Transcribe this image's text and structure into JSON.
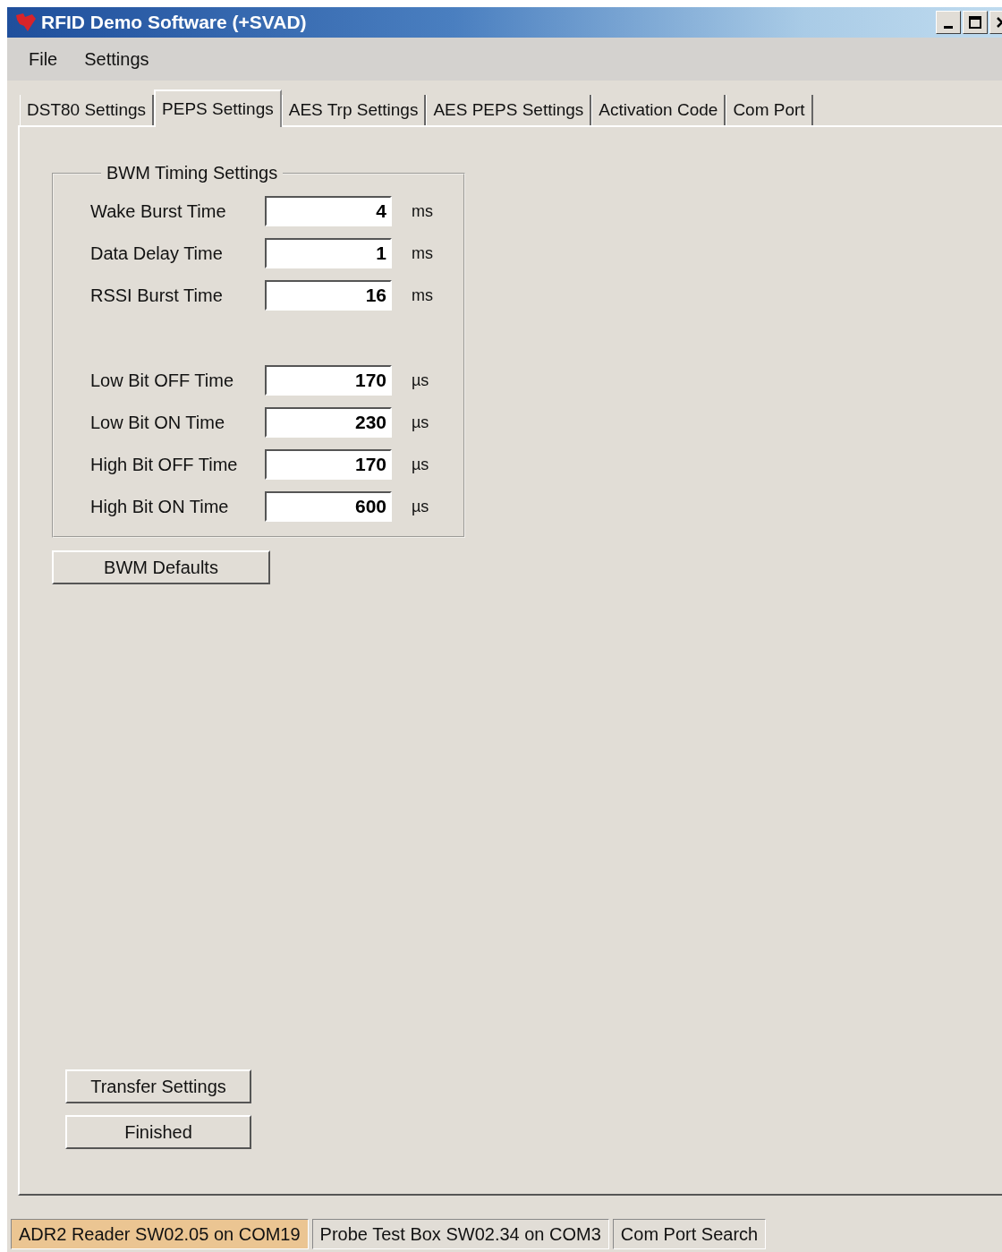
{
  "window": {
    "title": "RFID Demo Software (+SVAD)"
  },
  "menu": [
    "File",
    "Settings"
  ],
  "tabs": [
    {
      "label": "DST80 Settings",
      "selected": false
    },
    {
      "label": "PEPS Settings",
      "selected": true
    },
    {
      "label": "AES Trp Settings",
      "selected": false
    },
    {
      "label": "AES PEPS Settings",
      "selected": false
    },
    {
      "label": "Activation Code",
      "selected": false
    },
    {
      "label": "Com Port",
      "selected": false
    }
  ],
  "group": {
    "title": "BWM Timing Settings",
    "sections": [
      {
        "rows": [
          {
            "label": "Wake Burst Time",
            "value": "4",
            "unit": "ms"
          },
          {
            "label": "Data Delay Time",
            "value": "1",
            "unit": "ms"
          },
          {
            "label": "RSSI Burst Time",
            "value": "16",
            "unit": "ms"
          }
        ]
      },
      {
        "rows": [
          {
            "label": "Low Bit OFF Time",
            "value": "170",
            "unit": "µs"
          },
          {
            "label": "Low Bit ON Time",
            "value": "230",
            "unit": "µs"
          },
          {
            "label": "High Bit OFF Time",
            "value": "170",
            "unit": "µs"
          },
          {
            "label": "High Bit ON Time",
            "value": "600",
            "unit": "µs"
          }
        ]
      }
    ]
  },
  "defaults_button": "BWM Defaults",
  "action_buttons": [
    "Transfer Settings",
    "Finished"
  ],
  "status_bar": [
    {
      "text": "ADR2 Reader SW02.05 on COM19",
      "selected": true
    },
    {
      "text": "Probe Test Box SW02.34 on COM3",
      "selected": false
    },
    {
      "text": "Com Port Search",
      "selected": false
    }
  ]
}
